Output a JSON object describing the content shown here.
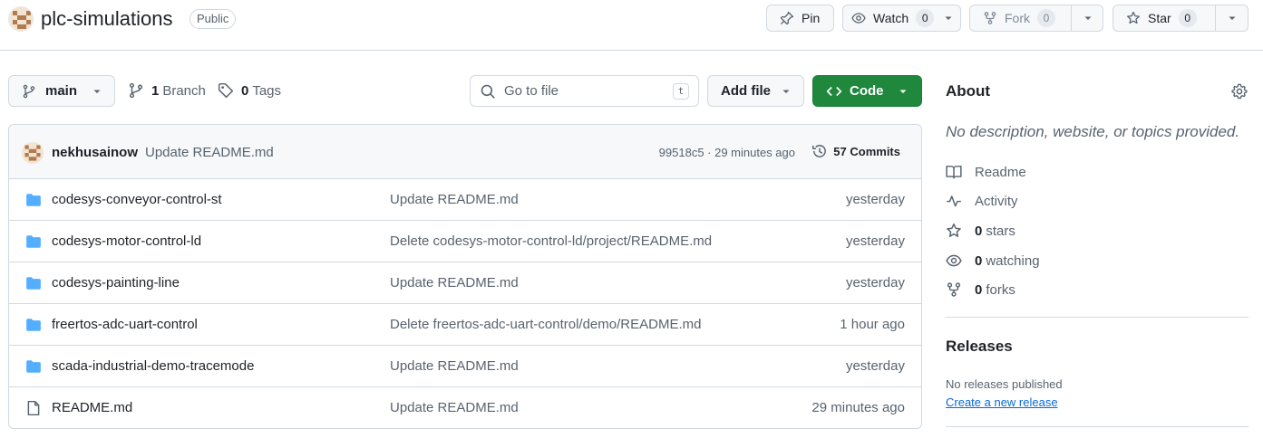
{
  "repo": {
    "name": "plc-simulations",
    "visibility": "Public"
  },
  "header_actions": {
    "pin_label": "Pin",
    "watch_label": "Watch",
    "watch_count": "0",
    "fork_label": "Fork",
    "fork_count": "0",
    "star_label": "Star",
    "star_count": "0"
  },
  "toolbar": {
    "branch": "main",
    "branches_count": "1",
    "branches_label": "Branch",
    "tags_count": "0",
    "tags_label": "Tags",
    "search_placeholder": "Go to file",
    "search_shortcut": "t",
    "add_file_label": "Add file",
    "code_label": "Code"
  },
  "latest_commit": {
    "author": "nekhusainow",
    "message": "Update README.md",
    "hash_time": "99518c5 · 29 minutes ago",
    "commits_label": "57 Commits"
  },
  "files": [
    {
      "icon": "folder-icon",
      "name": "codesys-conveyor-control-st",
      "message": "Update README.md",
      "time": "yesterday"
    },
    {
      "icon": "folder-icon",
      "name": "codesys-motor-control-ld",
      "message": "Delete codesys-motor-control-ld/project/README.md",
      "time": "yesterday"
    },
    {
      "icon": "folder-icon",
      "name": "codesys-painting-line",
      "message": "Update README.md",
      "time": "yesterday"
    },
    {
      "icon": "folder-icon",
      "name": "freertos-adc-uart-control",
      "message": "Delete freertos-adc-uart-control/demo/README.md",
      "time": "1 hour ago"
    },
    {
      "icon": "folder-icon",
      "name": "scada-industrial-demo-tracemode",
      "message": "Update README.md",
      "time": "yesterday"
    },
    {
      "icon": "file-icon",
      "name": "README.md",
      "message": "Update README.md",
      "time": "29 minutes ago"
    }
  ],
  "about": {
    "title": "About",
    "description": "No description, website, or topics provided.",
    "readme": "Readme",
    "activity": "Activity",
    "stars_count": "0",
    "stars_label": "stars",
    "watching_count": "0",
    "watching_label": "watching",
    "forks_count": "0",
    "forks_label": "forks"
  },
  "releases": {
    "title": "Releases",
    "none_text": "No releases published",
    "create_link": "Create a new release"
  },
  "colors": {
    "accent_green": "#1f883d",
    "link_blue": "#0969da",
    "folder_blue": "#54aeff",
    "muted": "#59636e"
  }
}
